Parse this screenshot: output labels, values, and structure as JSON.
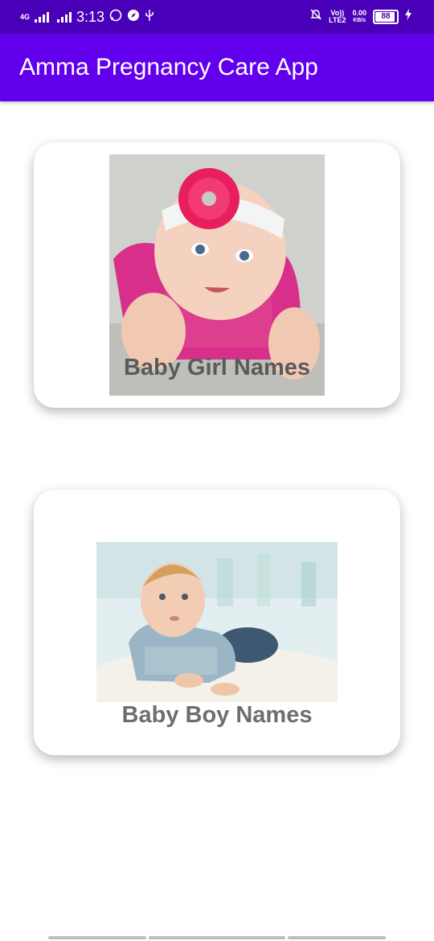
{
  "status_bar": {
    "network": "4G",
    "time": "3:13",
    "volte": "Vo))",
    "lte": "LTE2",
    "speed_value": "0.00",
    "speed_unit": "KB/s",
    "battery": "88",
    "icons": [
      "signal-icon",
      "whatsapp-icon",
      "compass-icon",
      "usb-icon",
      "mute-icon",
      "charging-icon"
    ]
  },
  "app_bar": {
    "title": "Amma Pregnancy Care App",
    "color": "#6200ee"
  },
  "cards": [
    {
      "label": "Baby Girl Names",
      "image": "baby-girl-photo"
    },
    {
      "label": "Baby Boy Names",
      "image": "baby-boy-photo"
    }
  ],
  "colors": {
    "status_bar": "#4a00b8",
    "app_bar": "#6200ee",
    "card_label": "#6e6e6e"
  }
}
